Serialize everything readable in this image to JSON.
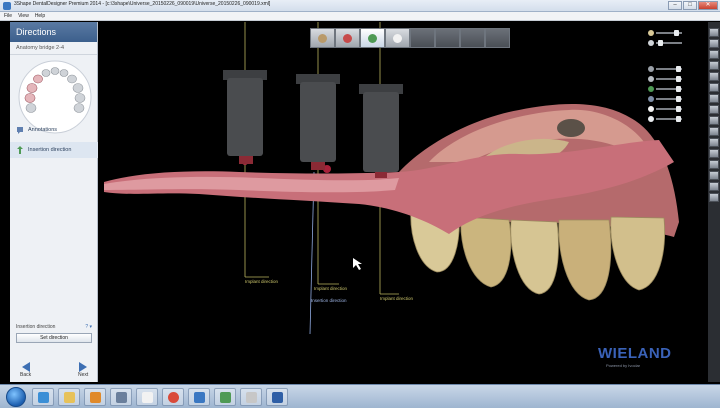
{
  "window": {
    "title": "3Shape DentalDesigner Premium 2014 - [c:\\3shape\\Universe_20150226_090019\\Universe_20150226_090019.xml]",
    "minimize_glyph": "–",
    "maximize_glyph": "□",
    "close_glyph": "✕"
  },
  "menubar": {
    "items": [
      "File",
      "View",
      "Help"
    ]
  },
  "sidebar": {
    "header": "Directions",
    "subheader": "Anatomy bridge 2-4",
    "items": [
      {
        "label": "Annotations",
        "icon": "annotation-icon"
      },
      {
        "label": "Insertion direction",
        "icon": "insertion-direction-icon"
      }
    ],
    "insertion_direction_label": "Insertion direction",
    "help_glyph": "? ▾",
    "set_direction_button": "Set direction",
    "back_label": "Back",
    "next_label": "Next"
  },
  "viewport": {
    "guide_labels": [
      "Implant direction",
      "Implant direction",
      "Insertion direction",
      "Implant direction"
    ]
  },
  "brand": {
    "name": "WIELAND",
    "tagline": "Powered by Ivoclar"
  },
  "colors": {
    "accent": "#3a62b8",
    "gum": "#c86f79",
    "tooth": "#d8c99a",
    "post": "#4a4c4f",
    "guide": "#c9c36a"
  }
}
